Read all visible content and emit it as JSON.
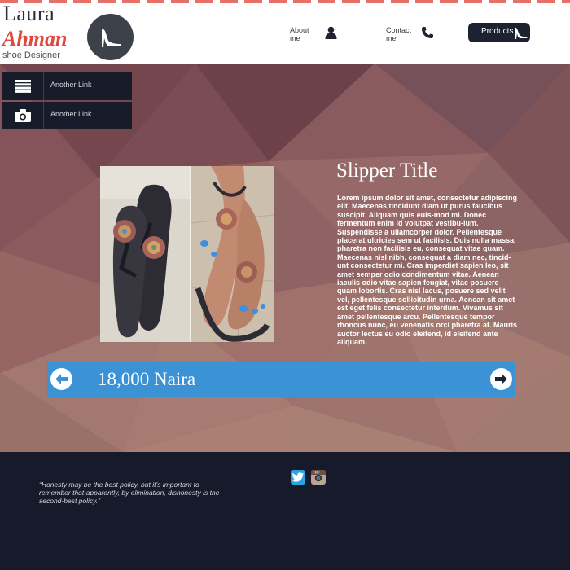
{
  "brand": {
    "first_name": "Laura",
    "last_name": "Ahman",
    "subtitle": "shoe Designer",
    "accent_color": "#e0483d"
  },
  "nav": {
    "about_label": "About\nme",
    "contact_label": "Contact\nme",
    "products_label": "Products",
    "icons": [
      "user-icon",
      "phone-icon",
      "high-heel-icon"
    ]
  },
  "side_menu": {
    "items": [
      {
        "label": "Another Link",
        "icon": "hamburger-menu-icon"
      },
      {
        "label": "Another Link",
        "icon": "camera-icon"
      }
    ]
  },
  "product": {
    "title": "Slipper Title",
    "description": "Lorem ipsum dolor sit amet, consectetur adipiscing elit. Maecenas tincidunt diam ut purus faucibus suscipit. Aliquam quis euis-mod mi. Donec fermentum enim id volutpat vestibu-lum. Suspendisse a ullamcorper dolor. Pellentesque placerat ultricies sem ut facilisis. Duis nulla massa, pharetra non facilisis eu, consequat vitae quam. Maecenas nisl nibh, consequat a diam nec, tincid-unt consectetur mi. Cras imperdiet sapien leo, sit amet semper odio condimentum vitae. Aenean iaculis odio vitae sapien feugiat, vitae posuere quam lobortis. Cras nisl lacus, posuere sed velit vel, pellentesque sollicitudin urna. Aenean sit amet est eget felis consectetur interdum. Vivamus sit amet pellentesque arcu. Pellentesque tempor rhoncus nunc, eu venenatis orci pharetra at. Mauris auctor lectus eu odio eleifend, id eleifend ante aliquam.",
    "price": "18,000 Naira",
    "price_bar_color": "#3b93d6"
  },
  "footer": {
    "quote": "“Honesty may be the best policy, but it’s important to remember that apparently, by elimination, dishonesty is the second-best policy.”",
    "social": [
      "twitter-icon",
      "instagram-icon"
    ]
  }
}
